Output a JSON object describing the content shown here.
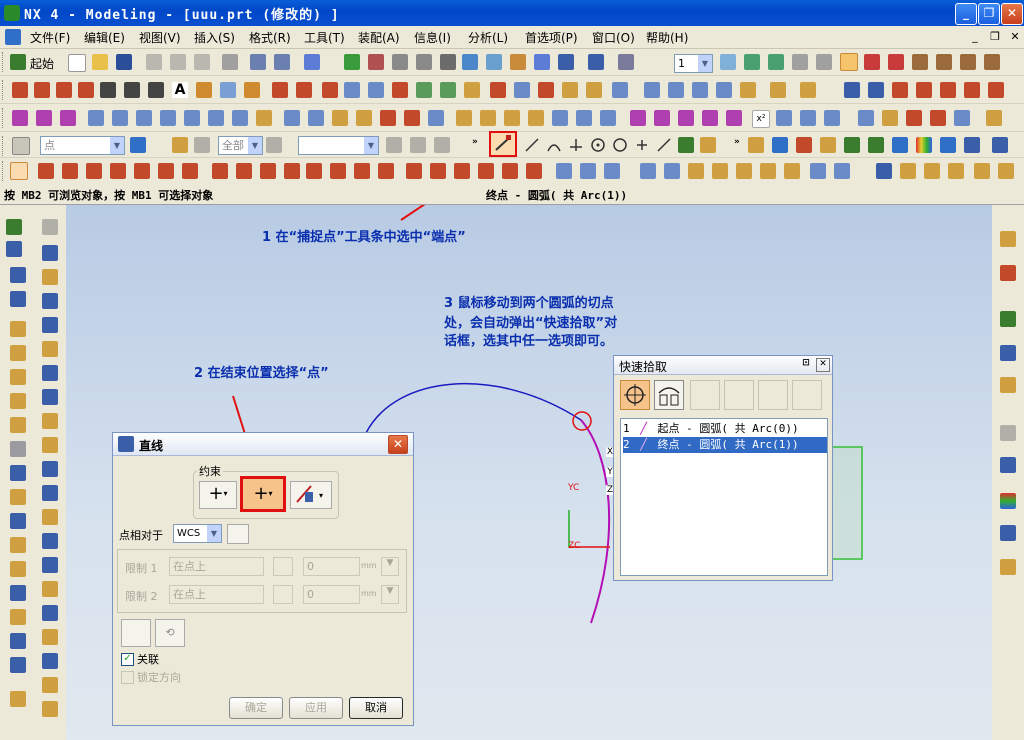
{
  "window": {
    "title": "NX 4 - Modeling - [uuu.prt  (修改的) ]",
    "minimize_label": "_",
    "restore_label": "❐",
    "close_label": "✕"
  },
  "menubar": {
    "items": [
      "文件(F)",
      "编辑(E)",
      "视图(V)",
      "插入(S)",
      "格式(R)",
      "工具(T)",
      "装配(A)",
      "信息(I)",
      "分析(L)",
      "首选项(P)",
      "窗口(O)",
      "帮助(H)"
    ],
    "doc_minimize": "_",
    "doc_restore": "❐",
    "doc_close": "✕"
  },
  "toolbar1": {
    "start_label": "起始",
    "layer_value": "1"
  },
  "toolbar4": {
    "point_combo": "点",
    "filter_combo": "全部",
    "blank_combo": ""
  },
  "status": {
    "prompt": "按 MB2 可浏览对象，按 MB1 可选择对象",
    "selection": "终点 - 圆弧( 共 Arc(1))"
  },
  "annotations": {
    "note1": "1  在“捕捉点”工具条中选中“端点”",
    "note2": "2  在结束位置选择“点”",
    "note3_line1": "3  鼠标移动到两个圆弧的切点",
    "note3_line2": "处，会自动弹出“快速拾取”对",
    "note3_line3": "话框，选其中任一选项即可。"
  },
  "axes": {
    "yc": "YC",
    "zc": "ZC",
    "x": "X",
    "y": "Y",
    "z": "Z"
  },
  "line_dialog": {
    "title": "直线",
    "group_label": "约束",
    "point_relative_label": "点相对于",
    "point_relative_value": "WCS",
    "limit1_label": "限制 1",
    "limit1_option": "在点上",
    "limit1_value": "0",
    "limit2_label": "限制 2",
    "limit2_option": "在点上",
    "limit2_value": "0",
    "unit": "mm",
    "associative_label": "关联",
    "associative_checked": true,
    "lock_direction_label": "锁定方向",
    "ok_label": "确定",
    "apply_label": "应用",
    "cancel_label": "取消"
  },
  "quick_pick": {
    "title": "快速拾取",
    "items": [
      {
        "index": "1",
        "text": "起点 - 圆弧( 共 Arc(0))",
        "selected": false
      },
      {
        "index": "2",
        "text": "终点 - 圆弧( 共 Arc(1))",
        "selected": true
      }
    ]
  },
  "colors": {
    "title_bar": "#0a4fd0",
    "annotation_text": "#0a2fae",
    "highlight_border": "#e01010",
    "arc_blue": "#1a1ac0",
    "arc_magenta": "#b40fb4",
    "list_selection": "#316ac5"
  }
}
